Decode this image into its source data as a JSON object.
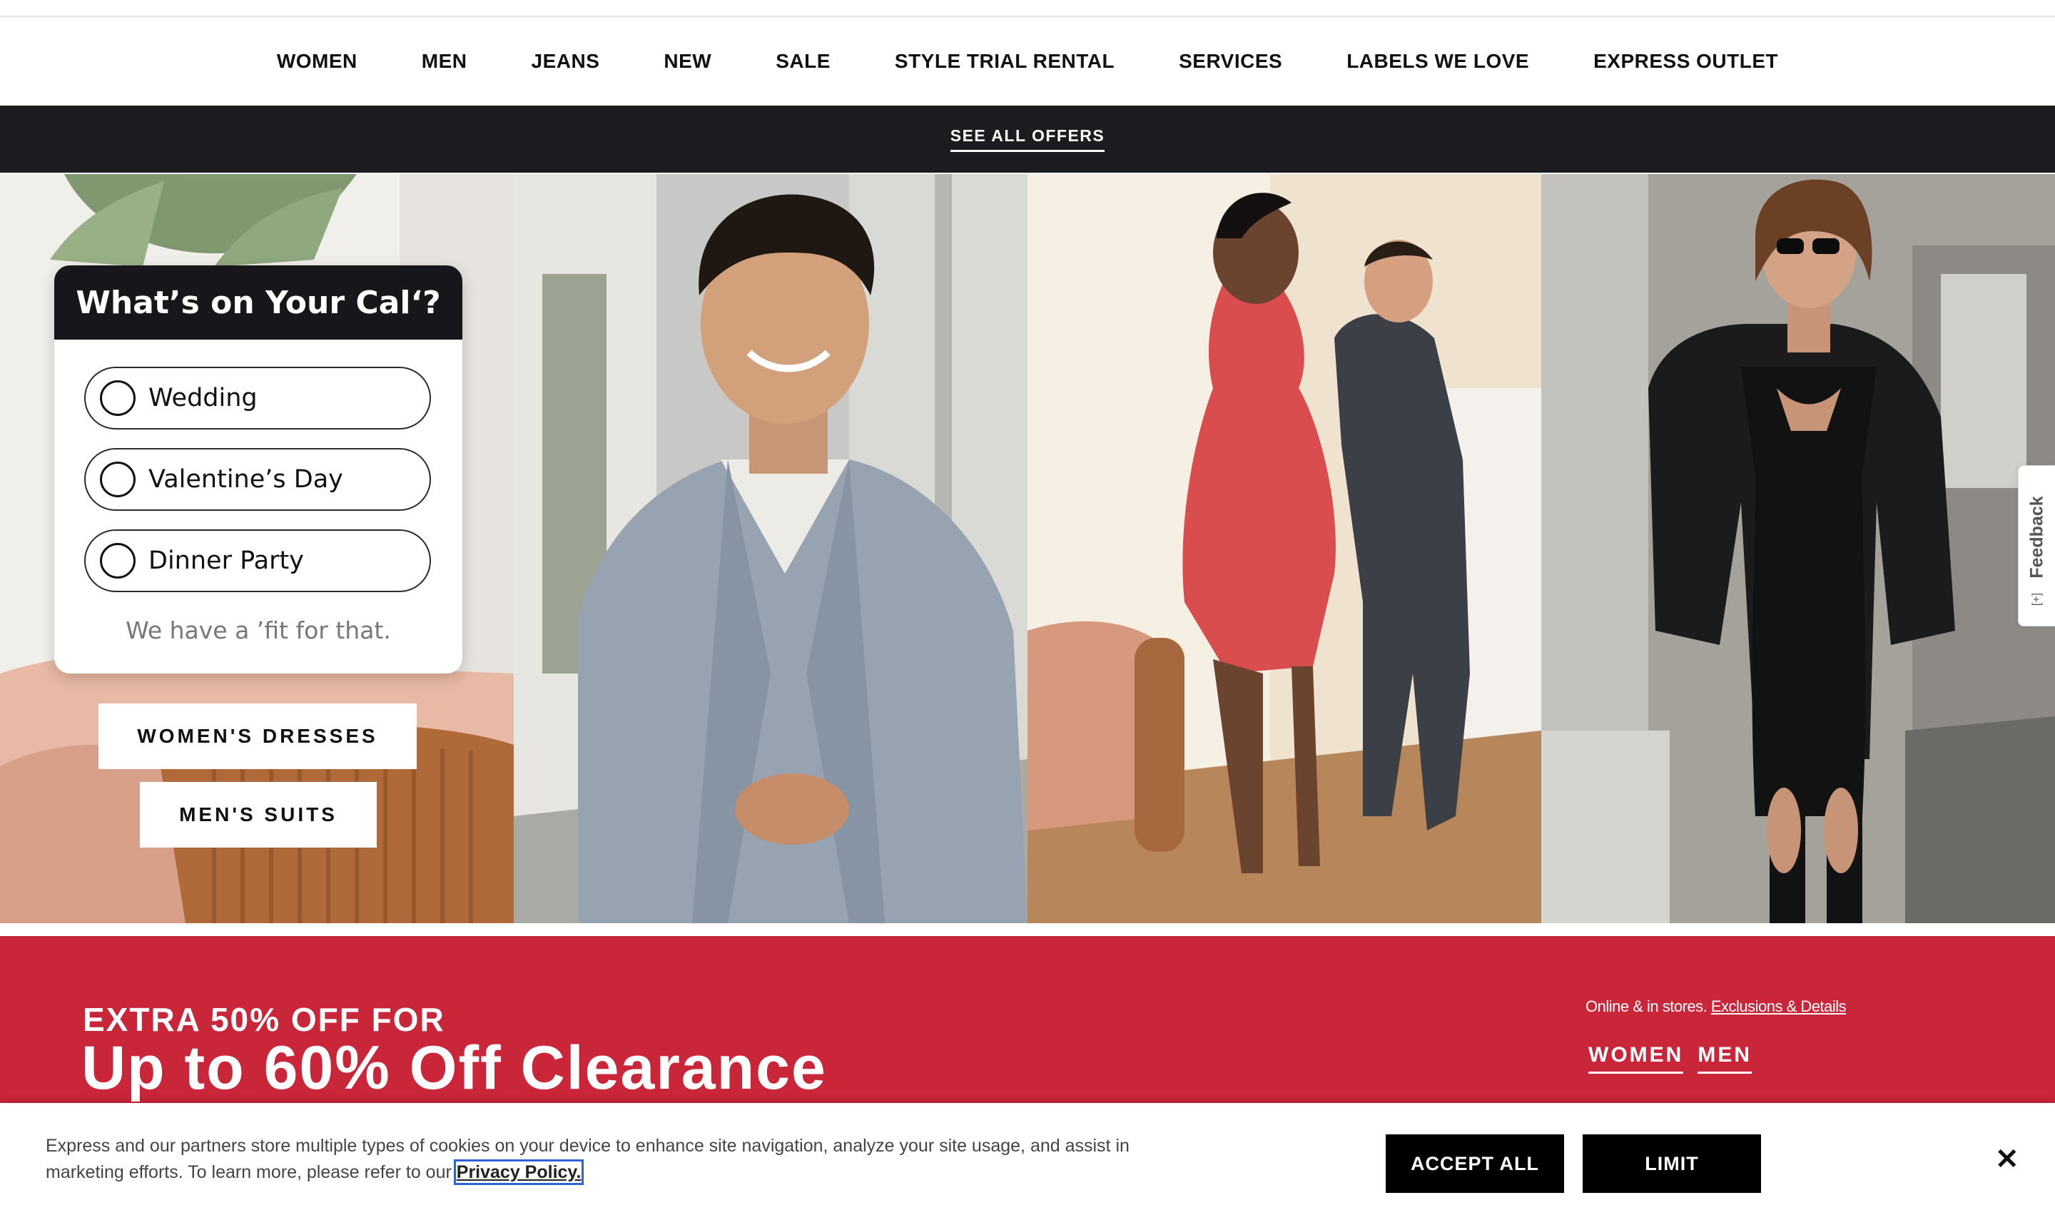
{
  "nav": {
    "items": [
      "WOMEN",
      "MEN",
      "JEANS",
      "NEW",
      "SALE",
      "STYLE TRIAL RENTAL",
      "SERVICES",
      "LABELS WE LOVE",
      "EXPRESS OUTLET"
    ]
  },
  "offers_bar": {
    "label": "SEE ALL OFFERS"
  },
  "calendar_card": {
    "title": "What’s on Your Cal‘?",
    "options": [
      "Wedding",
      "Valentine’s Day",
      "Dinner Party"
    ],
    "footer": "We have a ’fit for that."
  },
  "ctas": {
    "womens_dresses": "WOMEN'S DRESSES",
    "mens_suits": "MEN'S SUITS"
  },
  "promo": {
    "pre": "EXTRA 50% OFF FOR",
    "headline": "Up to 60% Off Clearance",
    "note": "Online & in stores.",
    "note_link": "Exclusions & Details",
    "links": [
      "WOMEN",
      "MEN"
    ]
  },
  "feedback": {
    "label": "Feedback",
    "icon": "[+]"
  },
  "cookie": {
    "message": "Express and our partners store multiple types of cookies on your device to enhance site navigation, analyze your site usage, and assist in marketing efforts. To learn more, please refer to our",
    "policy_link": "Privacy Policy.",
    "accept": "ACCEPT ALL",
    "limit": "LIMIT",
    "close": "✕"
  },
  "colors": {
    "offers_bar": "#1b1b20",
    "promo_red": "#c9263a",
    "cookie_button": "#000000"
  }
}
